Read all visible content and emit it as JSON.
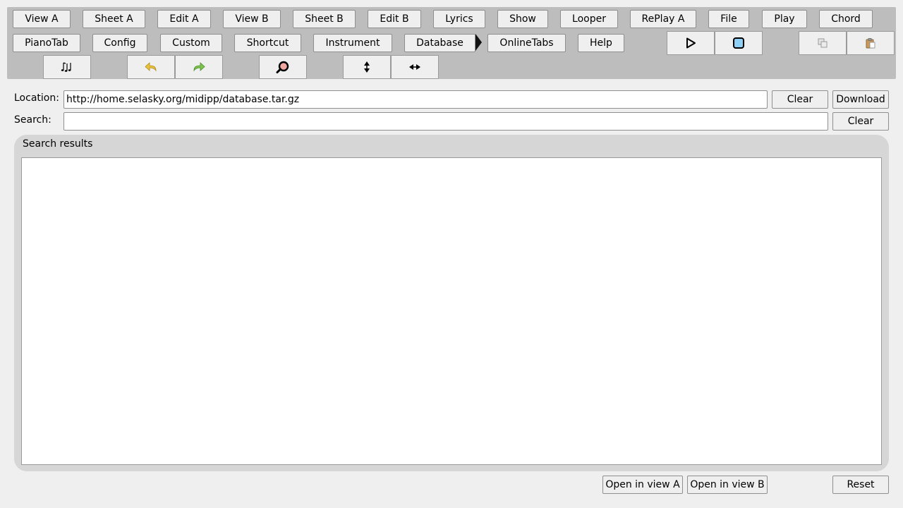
{
  "toolbar": {
    "row1": [
      "View A",
      "Sheet A",
      "Edit A",
      "View B",
      "Sheet B",
      "Edit B",
      "Lyrics",
      "Show",
      "Looper",
      "RePlay A",
      "File",
      "Play",
      "Chord"
    ],
    "row2": [
      "PianoTab",
      "Config",
      "Custom",
      "Shortcut",
      "Instrument",
      "Database",
      "OnlineTabs",
      "Help"
    ],
    "icons": {
      "play": "play-icon",
      "stop": "stop-icon",
      "copy": "copy-icon",
      "paste": "paste-icon",
      "notes": "music-notes-icon",
      "undo": "undo-icon",
      "redo": "redo-icon",
      "search": "magnifier-icon",
      "vertical": "vertical-resize-icon",
      "horizontal": "horizontal-resize-icon"
    },
    "colors": {
      "undo": "#e8c23a",
      "redo": "#7cc44a",
      "stop_fill": "#8fd0f7"
    }
  },
  "location": {
    "label": "Location:",
    "value": "http://home.selasky.org/midipp/database.tar.gz",
    "clear": "Clear",
    "download": "Download"
  },
  "search": {
    "label": "Search:",
    "value": "",
    "clear": "Clear"
  },
  "results": {
    "title": "Search results",
    "items": []
  },
  "footer": {
    "open_a": "Open in view A",
    "open_b": "Open in view B",
    "reset": "Reset"
  }
}
